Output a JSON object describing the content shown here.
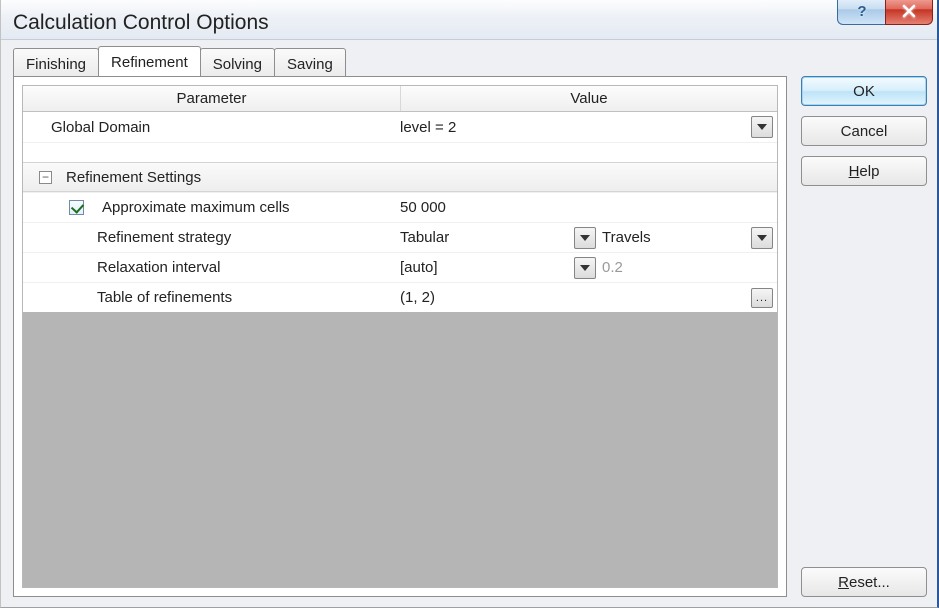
{
  "title": "Calculation Control Options",
  "tabs": [
    {
      "label": "Finishing",
      "active": false
    },
    {
      "label": "Refinement",
      "active": true
    },
    {
      "label": "Solving",
      "active": false
    },
    {
      "label": "Saving",
      "active": false
    }
  ],
  "grid": {
    "headers": {
      "param": "Parameter",
      "value": "Value"
    },
    "global_domain": {
      "label": "Global Domain",
      "value": "level = 2"
    },
    "section_label": "Refinement Settings",
    "approx_max_cells": {
      "label": "Approximate maximum cells",
      "value": "50 000",
      "checked": true
    },
    "refinement_strategy": {
      "label": "Refinement strategy",
      "value": "Tabular",
      "unit": "Travels"
    },
    "relaxation_interval": {
      "label": "Relaxation interval",
      "value": "[auto]",
      "override": "0.2"
    },
    "table_of_refinements": {
      "label": "Table of refinements",
      "value": "(1, 2)"
    }
  },
  "buttons": {
    "ok": "OK",
    "cancel": "Cancel",
    "help_prefix": "",
    "help_u": "H",
    "help_suffix": "elp",
    "reset_prefix": "",
    "reset_u": "R",
    "reset_suffix": "eset..."
  },
  "icons": {
    "help": "?",
    "close": "x",
    "ellipsis": "..."
  }
}
